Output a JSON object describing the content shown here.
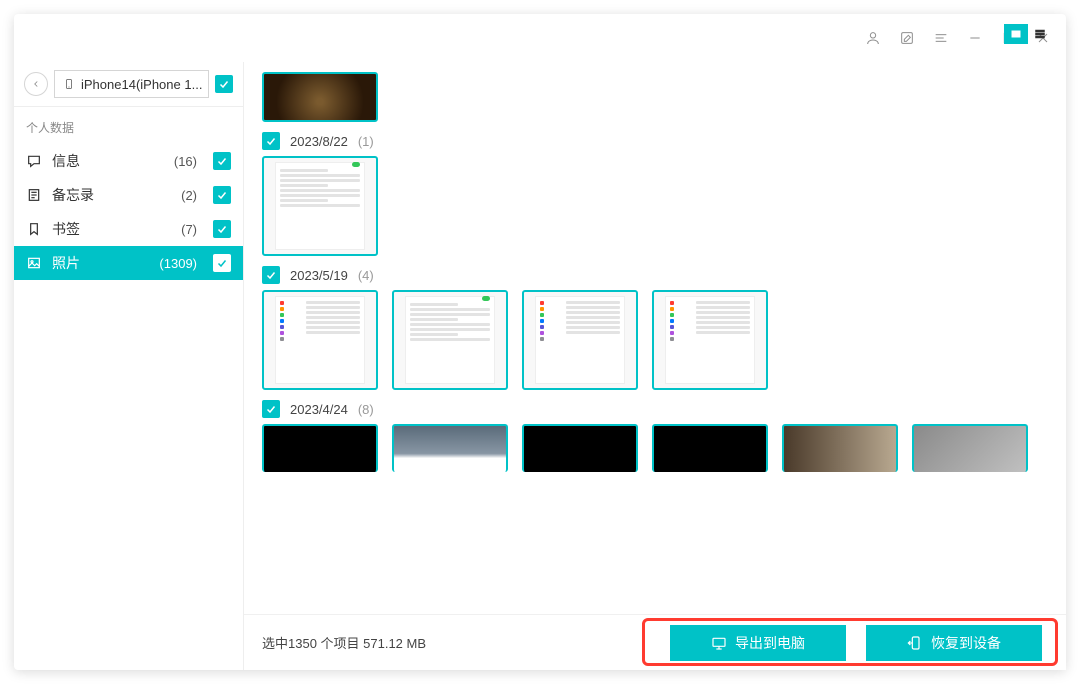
{
  "device": {
    "name": "iPhone14(iPhone 1..."
  },
  "sidebar": {
    "section_label": "个人数据",
    "items": [
      {
        "icon": "message",
        "label": "信息",
        "count": "(16)"
      },
      {
        "icon": "note",
        "label": "备忘录",
        "count": "(2)"
      },
      {
        "icon": "bookmark",
        "label": "书签",
        "count": "(7)"
      },
      {
        "icon": "image",
        "label": "照片",
        "count": "(1309)"
      }
    ]
  },
  "groups": [
    {
      "checked": false,
      "date": "",
      "count": "",
      "thumbs": [
        {
          "kind": "dark-blur"
        }
      ]
    },
    {
      "checked": true,
      "date": "2023/8/22",
      "count": "(1)",
      "thumbs": [
        {
          "kind": "screenshot-toggle"
        }
      ]
    },
    {
      "checked": true,
      "date": "2023/5/19",
      "count": "(4)",
      "thumbs": [
        {
          "kind": "screenshot-list"
        },
        {
          "kind": "screenshot-toggle"
        },
        {
          "kind": "screenshot-list"
        },
        {
          "kind": "screenshot-list"
        }
      ]
    },
    {
      "checked": true,
      "date": "2023/4/24",
      "count": "(8)",
      "thumbs": [
        {
          "kind": "black"
        },
        {
          "kind": "sky"
        },
        {
          "kind": "black"
        },
        {
          "kind": "black"
        },
        {
          "kind": "brown-grad"
        },
        {
          "kind": "gray-grad"
        }
      ]
    }
  ],
  "footer": {
    "status": "选中1350 个项目 571.12 MB",
    "export_label": "导出到电脑",
    "restore_label": "恢复到设备"
  }
}
